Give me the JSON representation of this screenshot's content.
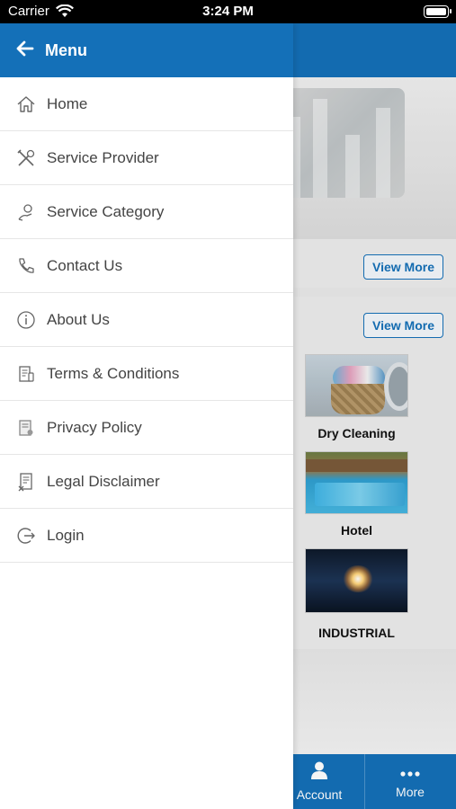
{
  "status_bar": {
    "carrier": "Carrier",
    "time": "3:24 PM"
  },
  "drawer": {
    "title": "Menu",
    "items": [
      {
        "label": "Home",
        "icon": "home-icon"
      },
      {
        "label": "Service Provider",
        "icon": "tools-icon"
      },
      {
        "label": "Service Category",
        "icon": "hand-service-icon"
      },
      {
        "label": "Contact Us",
        "icon": "phone-icon"
      },
      {
        "label": "About Us",
        "icon": "info-icon"
      },
      {
        "label": "Terms & Conditions",
        "icon": "document-icon"
      },
      {
        "label": "Privacy Policy",
        "icon": "privacy-document-icon"
      },
      {
        "label": "Legal Disclaimer",
        "icon": "legal-document-icon"
      },
      {
        "label": "Login",
        "icon": "login-icon"
      }
    ]
  },
  "background": {
    "view_more_1": "View More",
    "view_more_2": "View More",
    "categories": [
      {
        "label": "Dry Cleaning"
      },
      {
        "label": "Hotel"
      },
      {
        "label": "INDUSTRIAL"
      }
    ],
    "tabs": [
      {
        "label": "Account",
        "icon": "user-icon"
      },
      {
        "label": "More",
        "icon": "more-dots-icon"
      }
    ]
  },
  "colors": {
    "primary": "#1470b8",
    "menu_text": "#444444",
    "divider": "#e6e6e6"
  }
}
